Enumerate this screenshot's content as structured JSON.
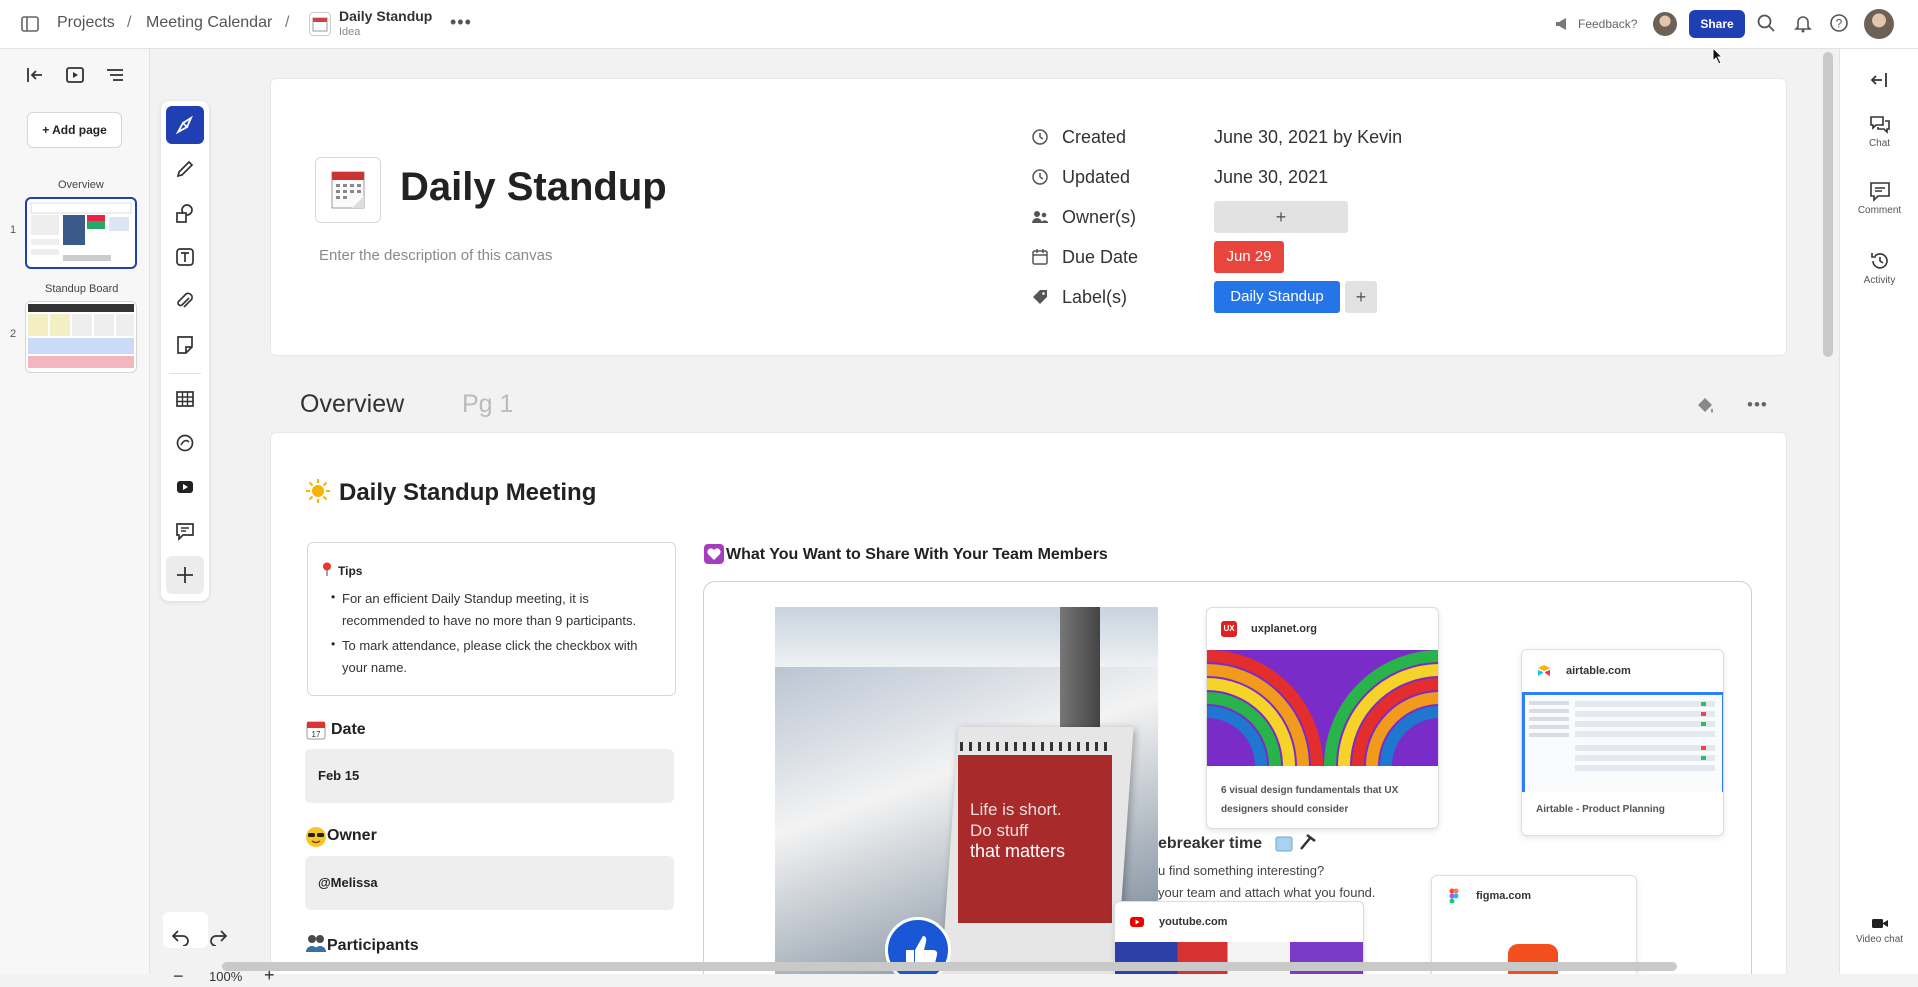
{
  "topbar": {
    "crumbs": [
      "Projects",
      "Meeting Calendar"
    ],
    "canvas_title": "Daily Standup",
    "canvas_subtitle": "Idea",
    "feedback": "Feedback?",
    "share": "Share"
  },
  "pages": {
    "add_page": "Add page",
    "items": [
      {
        "number": "1",
        "label": "Overview"
      },
      {
        "number": "2",
        "label": "Standup Board"
      }
    ]
  },
  "zoom": {
    "value": "100%"
  },
  "right_rail": {
    "chat": "Chat",
    "comment": "Comment",
    "activity": "Activity",
    "video_chat": "Video chat"
  },
  "header": {
    "title": "Daily Standup",
    "description_placeholder": "Enter the description of this canvas",
    "properties": {
      "created_label": "Created",
      "created_value": "June 30, 2021 by Kevin",
      "updated_label": "Updated",
      "updated_value": "June 30, 2021",
      "owners_label": "Owner(s)",
      "owners_add": "+",
      "due_label": "Due Date",
      "due_value": "Jun 29",
      "labels_label": "Label(s)",
      "label_tag": "Daily Standup",
      "labels_add": "+"
    }
  },
  "tabs": {
    "overview": "Overview",
    "pg1": "Pg 1"
  },
  "content": {
    "heading": "Daily Standup Meeting",
    "tips": {
      "title": "Tips",
      "items": [
        "For an efficient Daily Standup meeting, it is recommended to have no more than 9 participants.",
        "To mark attendance, please click the checkbox with your name."
      ]
    },
    "date_label": "Date",
    "date_value": "Feb 15",
    "owner_label": "Owner",
    "owner_value": "@Melissa",
    "participants_label": "Participants",
    "share_heading": "What You Want to Share With Your Team Members",
    "calendar_text": [
      "Life is short.",
      "Do stuff",
      "that matters"
    ],
    "icebreaker_title": "ebreaker time",
    "icebreaker_lines": [
      "u find something interesting?",
      "your team and attach what you found."
    ],
    "links": [
      {
        "domain": "uxplanet.org",
        "caption": "6 visual design fundamentals that UX designers should consider"
      },
      {
        "domain": "airtable.com",
        "caption": "Airtable - Product Planning"
      },
      {
        "domain": "youtube.com"
      },
      {
        "domain": "figma.com"
      }
    ]
  },
  "colors": {
    "accent": "#1f3fb3",
    "due": "#e8453c",
    "label": "#2574e8"
  }
}
